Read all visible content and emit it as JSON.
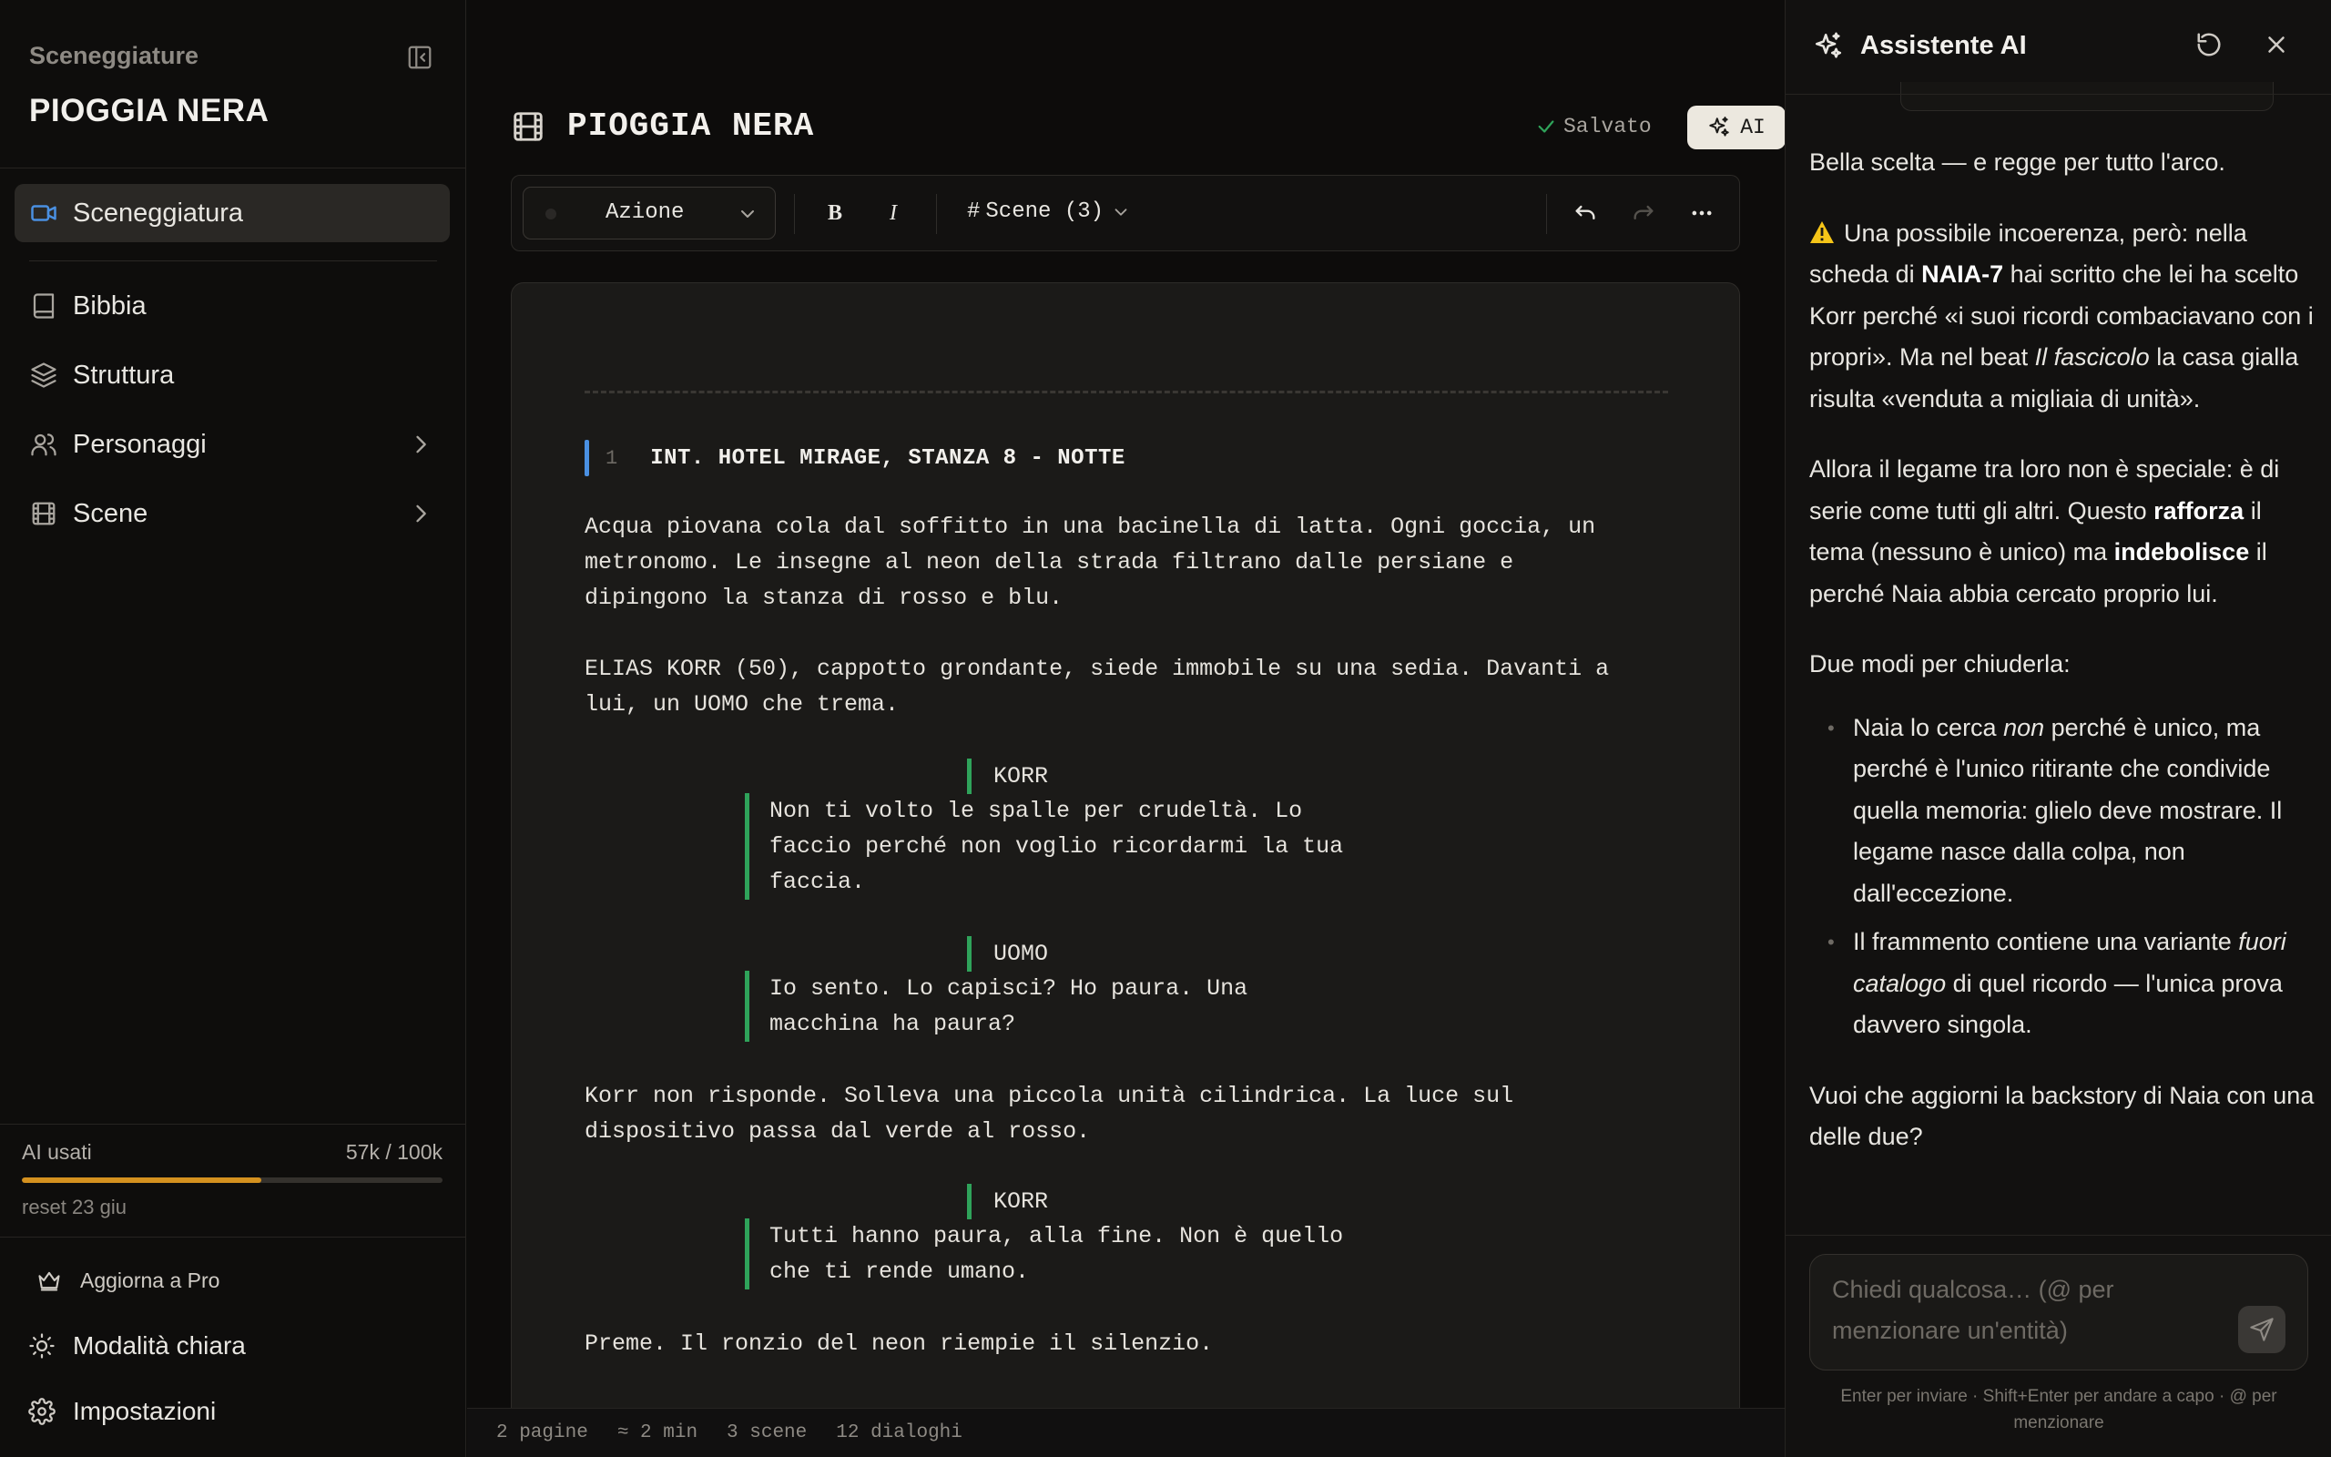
{
  "sidebar": {
    "app_name": "Sceneggiature",
    "project_title": "PIOGGIA NERA",
    "nav": {
      "sceneggiatura": "Sceneggiatura",
      "bibbia": "Bibbia",
      "struttura": "Struttura",
      "personaggi": "Personaggi",
      "scene": "Scene"
    },
    "usage": {
      "label": "AI usati",
      "value": "57k / 100k",
      "fraction": 0.57,
      "reset": "reset 23 giu"
    },
    "upgrade": "Aggiorna a Pro",
    "light_mode": "Modalità chiara",
    "settings": "Impostazioni"
  },
  "editor": {
    "title": "PIOGGIA NERA",
    "saved": "Salvato",
    "ai_button": "AI",
    "toolbar": {
      "element_type": "Azione",
      "bold": "B",
      "italic": "I",
      "scenes_hash": "#",
      "scenes": "Scene (3)"
    },
    "script": {
      "scene_number": "1",
      "scene_heading": "INT. HOTEL MIRAGE, STANZA 8 - NOTTE",
      "action1": "Acqua piovana cola dal soffitto in una bacinella di latta. Ogni goccia, un\nmetronomo. Le insegne al neon della strada filtrano dalle persiane e\ndipingono la stanza di rosso e blu.",
      "action2": "ELIAS KORR (50), cappotto grondante, siede immobile su una sedia. Davanti a\nlui, un UOMO che trema.",
      "char1": "KORR",
      "dialog1": "Non ti volto le spalle per crudeltà. Lo\nfaccio perché non voglio ricordarmi la tua\nfaccia.",
      "char2": "UOMO",
      "dialog2": "Io sento. Lo capisci? Ho paura. Una\nmacchina ha paura?",
      "action3": "Korr non risponde. Solleva una piccola unità cilindrica. La luce sul\ndispositivo passa dal verde al rosso.",
      "char3": "KORR",
      "dialog3": "Tutti hanno paura, alla fine. Non è quello\nche ti rende umano.",
      "action4": "Preme. Il ronzio del neon riempie il silenzio."
    },
    "status": {
      "pages": "2 pagine",
      "duration": "≈ 2 min",
      "scenes": "3 scene",
      "dialogs": "12 dialoghi"
    }
  },
  "assistant": {
    "title": "Assistente AI",
    "p1": "Bella scelta — e regge per tutto l'arco.",
    "p2_a": "Una possibile incoerenza, però: nella scheda di ",
    "p2_b": "NAIA-7",
    "p2_c": " hai scritto che lei ha scelto Korr perché «i suoi ricordi combaciavano con i propri». Ma nel beat ",
    "p2_d": "Il fascicolo",
    "p2_e": " la casa gialla risulta «venduta a migliaia di unità».",
    "p3_a": "Allora il legame tra loro non è speciale: è di serie come tutti gli altri. Questo ",
    "p3_b": "rafforza",
    "p3_c": " il tema (nessuno è unico) ma ",
    "p3_d": "indebolisce",
    "p3_e": " il perché Naia abbia cercato proprio lui.",
    "p4": "Due modi per chiuderla:",
    "li1_a": "Naia lo cerca ",
    "li1_b": "non",
    "li1_c": " perché è unico, ma perché è l'unico ritirante che condivide quella memoria: glielo deve mostrare. Il legame nasce dalla colpa, non dall'eccezione.",
    "li2_a": "Il frammento contiene una variante ",
    "li2_b": "fuori catalogo",
    "li2_c": " di quel ricordo — l'unica prova davvero singola.",
    "p5": "Vuoi che aggiorni la backstory di Naia con una delle due?",
    "input_placeholder": "Chiedi qualcosa… (@ per menzionare un'entità)",
    "hint": "Enter per inviare · Shift+Enter per andare a capo · @ per menzionare"
  },
  "colors": {
    "accent_blue": "#4a90e2",
    "dialogue_green": "#2fa35a",
    "usage_orange": "#d4911f",
    "warning_yellow": "#f5c518"
  },
  "icons": [
    "panel-collapse-icon",
    "video-icon",
    "book-icon",
    "layers-icon",
    "users-icon",
    "film-icon",
    "chevron-right-icon",
    "crown-icon",
    "sun-icon",
    "gear-icon",
    "check-icon",
    "sparkles-icon",
    "chevron-down-icon",
    "undo-icon",
    "redo-icon",
    "more-icon",
    "refresh-icon",
    "close-icon",
    "warning-icon",
    "send-icon"
  ]
}
